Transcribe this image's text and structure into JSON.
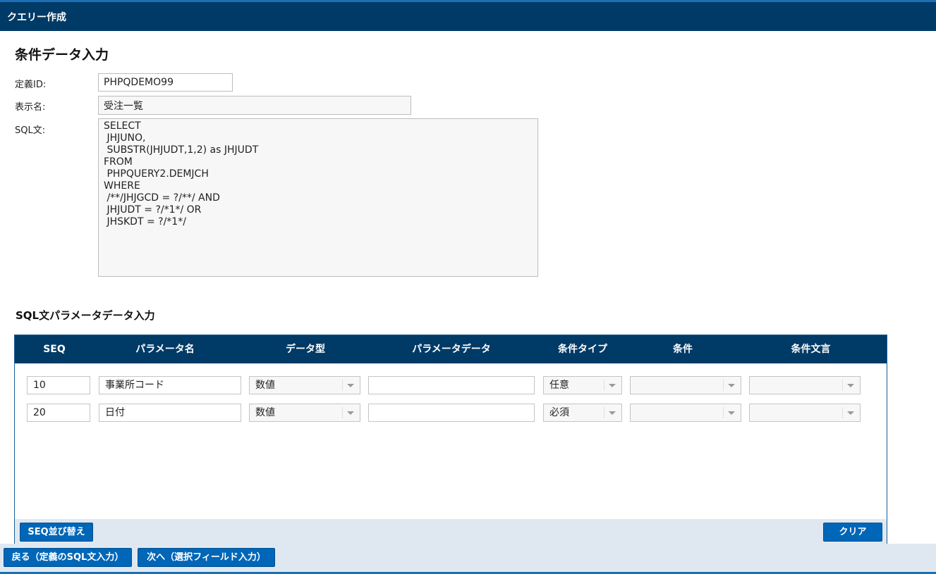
{
  "header": {
    "title": "クエリー作成"
  },
  "page_title": "条件データ入力",
  "form": {
    "definition_id_label": "定義ID:",
    "definition_id_value": "PHPQDEMO99",
    "display_name_label": "表示名:",
    "display_name_value": "受注一覧",
    "sql_label": "SQL文:",
    "sql_value": "SELECT\n JHJUNO,\n SUBSTR(JHJUDT,1,2) as JHJUDT\nFROM\n PHPQUERY2.DEMJCH\nWHERE\n /**/JHJGCD = ?/**/ AND\n JHJUDT = ?/*1*/ OR\n JHSKDT = ?/*1*/"
  },
  "param_section": {
    "title": "SQL文パラメータデータ入力",
    "columns": [
      "SEQ",
      "パラメータ名",
      "データ型",
      "パラメータデータ",
      "条件タイプ",
      "条件",
      "条件文言"
    ],
    "rows": [
      {
        "seq": "10",
        "name": "事業所コード",
        "type": "数値",
        "data": "",
        "cond_type": "任意",
        "cond": "",
        "cond_text": ""
      },
      {
        "seq": "20",
        "name": "日付",
        "type": "数値",
        "data": "",
        "cond_type": "必須",
        "cond": "",
        "cond_text": ""
      }
    ],
    "sort_button": "SEQ並び替え",
    "clear_button": "クリア"
  },
  "nav": {
    "back_button": "戻る（定義のSQL文入力）",
    "next_button": "次へ（選択フィールド入力）"
  },
  "colors": {
    "header_bg": "#003a66",
    "button_bg": "#0066b8",
    "strip_bg": "#dfe8f1"
  }
}
